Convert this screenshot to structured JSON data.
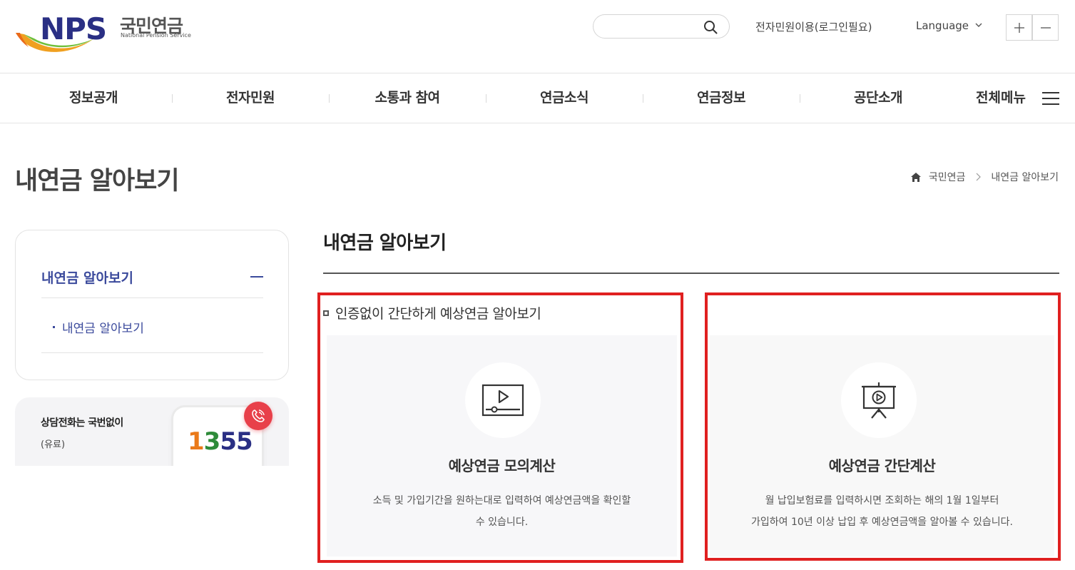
{
  "header": {
    "logo": {
      "text": "NPS",
      "korean": "국민연금",
      "english": "National Pension Service"
    },
    "search": {
      "placeholder": ""
    },
    "eservice_link": "전자민원이용(로그인필요)",
    "language_label": "Language",
    "zoom_in": "+",
    "zoom_out": "−"
  },
  "gnb": {
    "items": [
      "정보공개",
      "전자민원",
      "소통과 참여",
      "연금소식",
      "연금정보",
      "공단소개"
    ],
    "all_menu": "전체메뉴"
  },
  "page": {
    "title": "내연금 알아보기",
    "breadcrumb": [
      "국민연금",
      "내연금 알아보기"
    ]
  },
  "lnb": {
    "title": "내연금 알아보기",
    "sub_items": [
      "내연금 알아보기"
    ]
  },
  "call_banner": {
    "text": "상담전화는 국번없이",
    "sub": "(유료)",
    "number_digits": [
      "1",
      "3",
      "5",
      "5"
    ]
  },
  "main": {
    "title": "내연금 알아보기",
    "section_heading": "인증없이 간단하게 예상연금 알아보기",
    "cards": [
      {
        "icon": "video-player-icon",
        "title": "예상연금 모의계산",
        "desc_lines": [
          "소득 및 가입기간을 원하는대로 입력하여 예상연금액을 확인할",
          "수 있습니다."
        ]
      },
      {
        "icon": "presentation-board-icon",
        "title": "예상연금 간단계산",
        "desc_lines": [
          "월 납입보험료를 입력하시면 조회하는 해의 1월 1일부터",
          "가입하여 10년 이상 납입 후 예상연금액을 알아볼 수 있습니다."
        ]
      }
    ]
  },
  "colors": {
    "brand_navy": "#2a2f84",
    "accent_blue": "#3b4a9c",
    "highlight_red": "#e02020",
    "call_badge": "#e8404a"
  }
}
